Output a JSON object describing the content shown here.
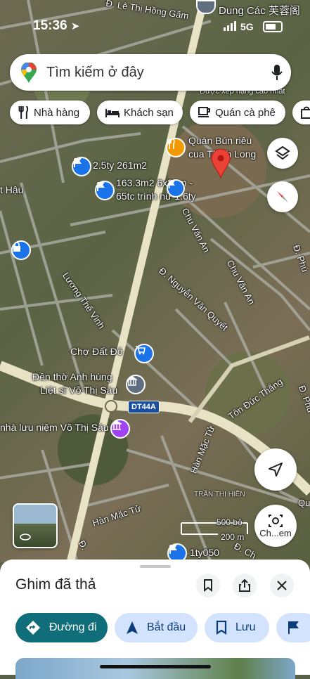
{
  "status_bar": {
    "time": "15:36",
    "network": "5G"
  },
  "search": {
    "placeholder": "Tìm kiếm ở đây"
  },
  "chips": [
    {
      "label": "Nhà hàng",
      "icon": "restaurant-icon"
    },
    {
      "label": "Khách sạn",
      "icon": "hotel-icon"
    },
    {
      "label": "Quán cà phê",
      "icon": "coffee-icon"
    }
  ],
  "map": {
    "labels": {
      "le_thi_hong_gam": "Đ. Lê Thị Hồng Gấm",
      "dung_cac": "Dung Các 芙蓉阁",
      "duoc_xep_hang": "Được xếp hạng cao nhất",
      "quan_bun_rieu_1": "Quán Bún riêu",
      "quan_bun_rieu_2": "cua Thịnh Long",
      "listing_1": "2.5ty 261m2",
      "listing_2a": "163.3m2 6x28m -",
      "listing_2b": "65tc trình nữ 1.6ty",
      "t_hau": "t Hậu",
      "chu_van_an_1": "Chu Văn An",
      "chu_van_an_2": "Chu Văn An",
      "nguyen_van_quyet": "Đ. Nguyễn Văn Quyết",
      "luong_the_vinh": "Lương Thế Vinh",
      "cho_dat_do": "Chợ Đất Đỏ",
      "den_tho_1": "Đền thờ Anh hùng",
      "den_tho_2": "Liệt sĩ Võ Thị Sáu",
      "route_badge": "DT44A",
      "ton_duc_thang": "Tôn Đức Thắng",
      "nha_luu_niem": "nhà lưu niệm Võ Thị Sáu",
      "han_mac_tu_1": "Hàn Mặc Tử",
      "han_mac_tu_2": "Hàn Mặc Tử",
      "tran_thi_hien": "TRẦN THỊ HIỀN",
      "d_phu": "Đ. Phú",
      "d_left": "Đ.",
      "listing_3": "1ty050",
      "d_cha": "Đ. Ch",
      "d_bottom_right": "Qu"
    },
    "scale": {
      "top": "500 bộ",
      "bottom": "200 m"
    },
    "chem_label": "Ch...em"
  },
  "sheet": {
    "title": "Ghim đã thả",
    "actions": [
      {
        "label": "Đường đi"
      },
      {
        "label": "Bắt đầu"
      },
      {
        "label": "Lưu"
      }
    ]
  },
  "colors": {
    "primary": "#0b57d0",
    "teal": "#0f6e79",
    "chip_bg": "#d3e3fd",
    "pin": "#ea4335"
  }
}
